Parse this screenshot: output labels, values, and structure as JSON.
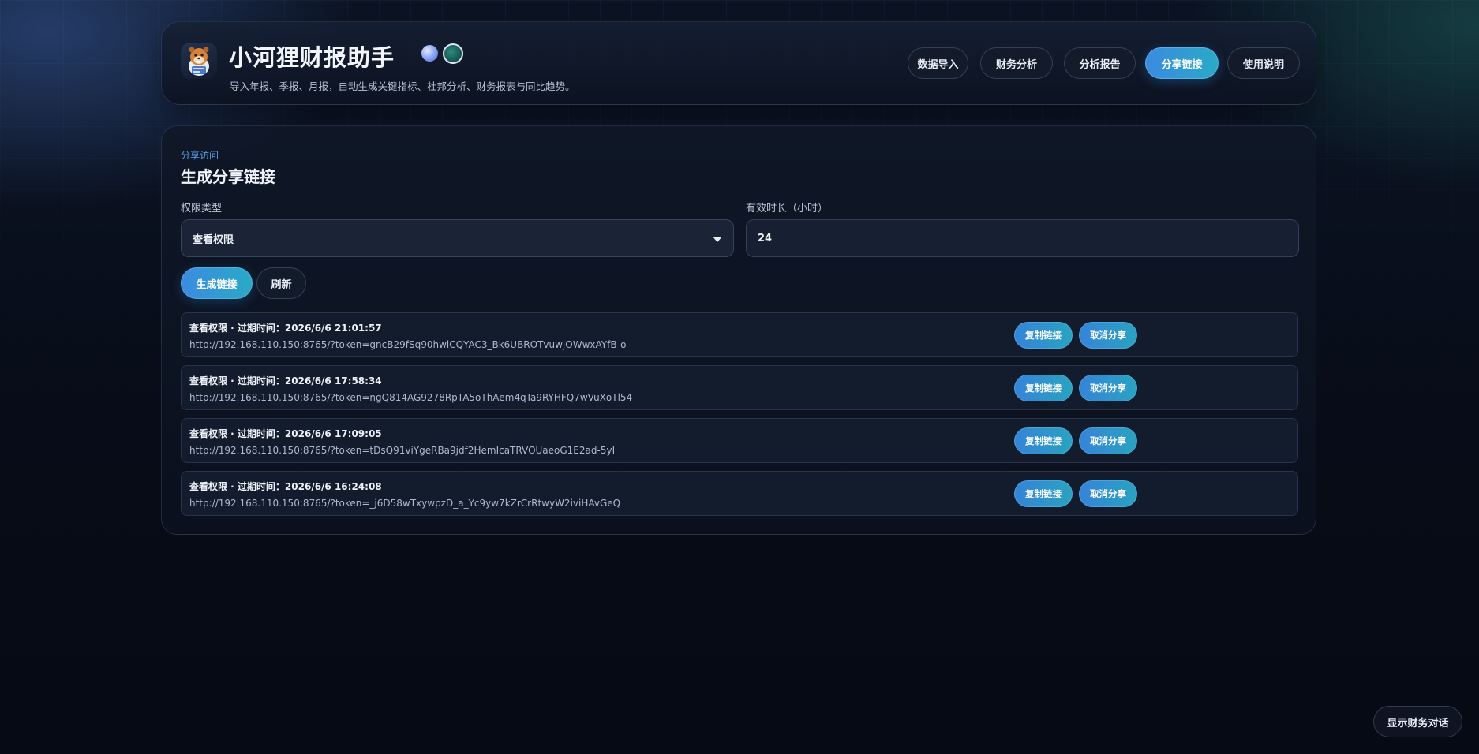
{
  "app": {
    "title": "小河狸财报助手",
    "tagline": "导入年报、季报、月报，自动生成关键指标、杜邦分析、财务报表与同比趋势。",
    "logo_icon": "beaver-mascot-icon"
  },
  "nav": {
    "items": [
      {
        "label": "数据导入",
        "active": false
      },
      {
        "label": "财务分析",
        "active": false
      },
      {
        "label": "分析报告",
        "active": false
      },
      {
        "label": "分享链接",
        "active": true
      },
      {
        "label": "使用说明",
        "active": false
      }
    ]
  },
  "panel": {
    "eyebrow": "分享访问",
    "title": "生成分享链接",
    "permission_label": "权限类型",
    "permission_value": "查看权限",
    "duration_label": "有效时长（小时）",
    "duration_value": "24",
    "generate_label": "生成链接",
    "refresh_label": "刷新"
  },
  "links": [
    {
      "meta": "查看权限 · 过期时间：2026/6/6 21:01:57",
      "url": "http://192.168.110.150:8765/?token=gncB29fSq90hwlCQYAC3_Bk6UBROTvuwjOWwxAYfB-o",
      "copy_label": "复制链接",
      "cancel_label": "取消分享"
    },
    {
      "meta": "查看权限 · 过期时间：2026/6/6 17:58:34",
      "url": "http://192.168.110.150:8765/?token=ngQ814AG9278RpTA5oThAem4qTa9RYHFQ7wVuXoTl54",
      "copy_label": "复制链接",
      "cancel_label": "取消分享"
    },
    {
      "meta": "查看权限 · 过期时间：2026/6/6 17:09:05",
      "url": "http://192.168.110.150:8765/?token=tDsQ91viYgeRBa9jdf2HemIcaTRVOUaeoG1E2ad-5yI",
      "copy_label": "复制链接",
      "cancel_label": "取消分享"
    },
    {
      "meta": "查看权限 · 过期时间：2026/6/6 16:24:08",
      "url": "http://192.168.110.150:8765/?token=_j6D58wTxywpzD_a_Yc9yw7kZrCrRtwyW2iviHAvGeQ",
      "copy_label": "复制链接",
      "cancel_label": "取消分享"
    }
  ],
  "chat_toggle": {
    "label": "显示财务对话"
  },
  "colors": {
    "accent_start": "#3b8be0",
    "accent_end": "#2aa9c6",
    "eyebrow": "#5aa0ef",
    "background": "#070c18"
  }
}
